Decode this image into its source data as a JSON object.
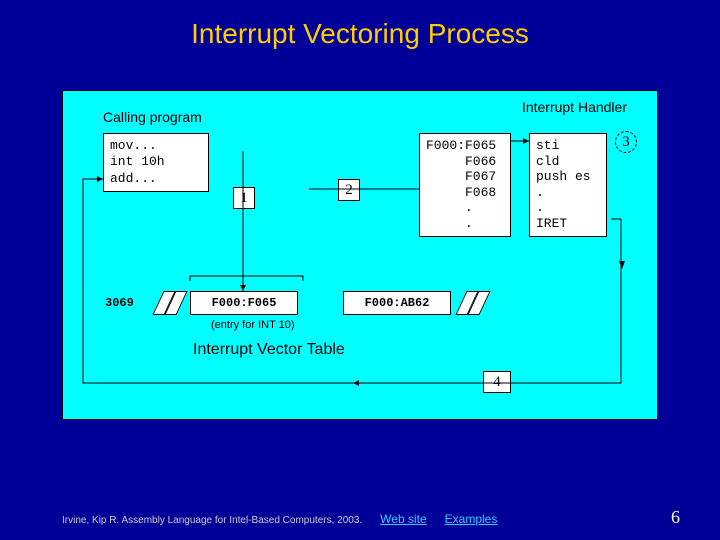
{
  "title": "Interrupt Vectoring Process",
  "diagram": {
    "calling_label": "Calling program",
    "handler_label": "Interrupt Handler",
    "calling_code": "mov...\nint 10h\nadd...",
    "addresses": "F000:F065\n     F066\n     F067\n     F068\n     .\n     .",
    "handler_code": "sti\ncld\npush es\n.\n.\nIRET",
    "steps": {
      "s1": "1",
      "s2": "2",
      "s3": "3",
      "s4": "4"
    },
    "table": {
      "left_addr": "3069",
      "cell1": "F000:F065",
      "cell2": "F000:AB62",
      "entry_note": "(entry for INT 10)",
      "title": "Interrupt Vector Table"
    }
  },
  "footer": {
    "credit": "Irvine, Kip R. Assembly Language for Intel-Based Computers, 2003.",
    "web": "Web site",
    "examples": "Examples"
  },
  "page": "6"
}
